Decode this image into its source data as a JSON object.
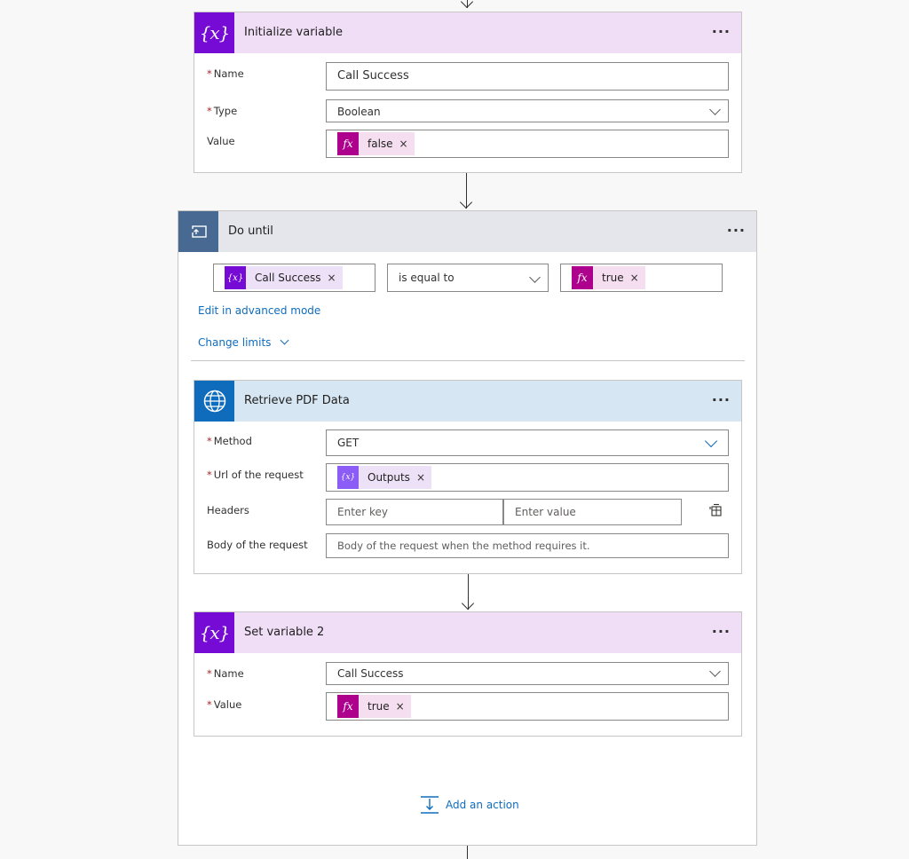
{
  "init_variable": {
    "title": "Initialize variable",
    "name_label": "Name",
    "name_value": "Call Success",
    "type_label": "Type",
    "type_value": "Boolean",
    "value_label": "Value",
    "value_token": "false"
  },
  "do_until": {
    "title": "Do until",
    "condition_left": "Call Success",
    "operator": "is equal to",
    "condition_right": "true",
    "advanced_link": "Edit in advanced mode",
    "change_limits": "Change limits",
    "add_action": "Add an action"
  },
  "http_action": {
    "title": "Retrieve PDF Data",
    "method_label": "Method",
    "method_value": "GET",
    "url_label": "Url of the request",
    "url_token": "Outputs",
    "headers_label": "Headers",
    "header_key_placeholder": "Enter key",
    "header_value_placeholder": "Enter value",
    "body_label": "Body of the request",
    "body_placeholder": "Body of the request when the method requires it."
  },
  "set_variable": {
    "title": "Set variable 2",
    "name_label": "Name",
    "name_value": "Call Success",
    "value_label": "Value",
    "value_token": "true"
  },
  "glyphs": {
    "var_icon": "{x}",
    "fx_icon": "fx",
    "remove": "×",
    "more": "···",
    "required": "*"
  },
  "colors": {
    "variable_accent": "#770bd6",
    "http_accent": "#0f6cbd",
    "loop_accent": "#486991",
    "expression_token": "#ad008c",
    "link": "#0f6cbd"
  }
}
